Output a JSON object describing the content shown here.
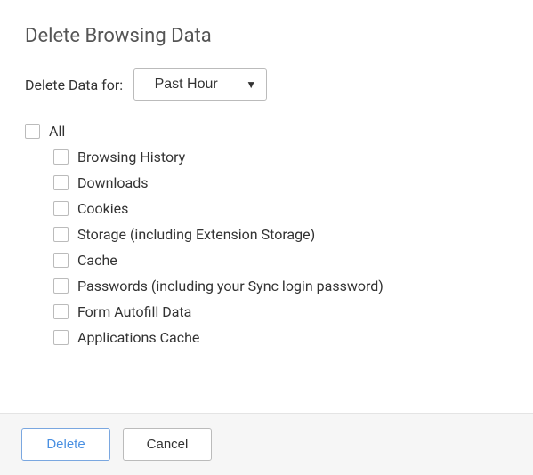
{
  "title": "Delete Browsing Data",
  "timeRange": {
    "label": "Delete Data for:",
    "selected": "Past Hour"
  },
  "allOption": {
    "label": "All",
    "checked": false
  },
  "items": [
    {
      "label": "Browsing History",
      "checked": false
    },
    {
      "label": "Downloads",
      "checked": false
    },
    {
      "label": "Cookies",
      "checked": false
    },
    {
      "label": "Storage (including Extension Storage)",
      "checked": false
    },
    {
      "label": "Cache",
      "checked": false
    },
    {
      "label": "Passwords (including your Sync login password)",
      "checked": false
    },
    {
      "label": "Form Autofill Data",
      "checked": false
    },
    {
      "label": "Applications Cache",
      "checked": false
    }
  ],
  "buttons": {
    "delete": "Delete",
    "cancel": "Cancel"
  }
}
